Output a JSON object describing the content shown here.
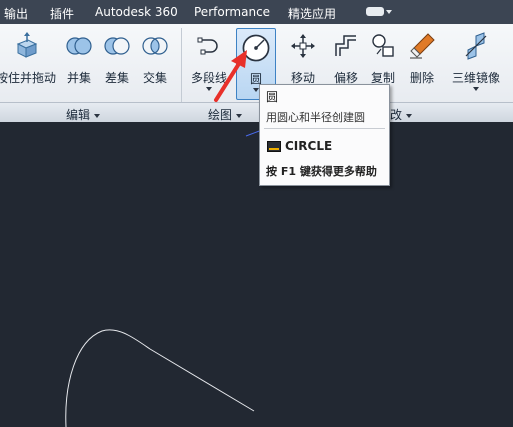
{
  "menubar": {
    "items": [
      "输出",
      "插件",
      "Autodesk 360",
      "Performance",
      "精选应用"
    ]
  },
  "ribbon": {
    "tools": {
      "move_drag": "按住并拖动",
      "union": "并集",
      "subtract": "差集",
      "intersect": "交集",
      "polyline": "多段线",
      "circle": "圆",
      "move": "移动",
      "offset": "偏移",
      "copy": "复制",
      "erase": "删除",
      "mirror3d": "三维镜像"
    },
    "panels": {
      "edit": "编辑",
      "draw": "绘图",
      "modify_tail": "改"
    }
  },
  "tooltip": {
    "title": "圆",
    "description": "用圆心和半径创建圆",
    "command": "CIRCLE",
    "help": "按 F1 键获得更多帮助"
  },
  "colors": {
    "menubar_bg": "#3c4553",
    "canvas_bg": "#222832",
    "arrow": "#e8302a",
    "accent": "#3d82c4"
  }
}
